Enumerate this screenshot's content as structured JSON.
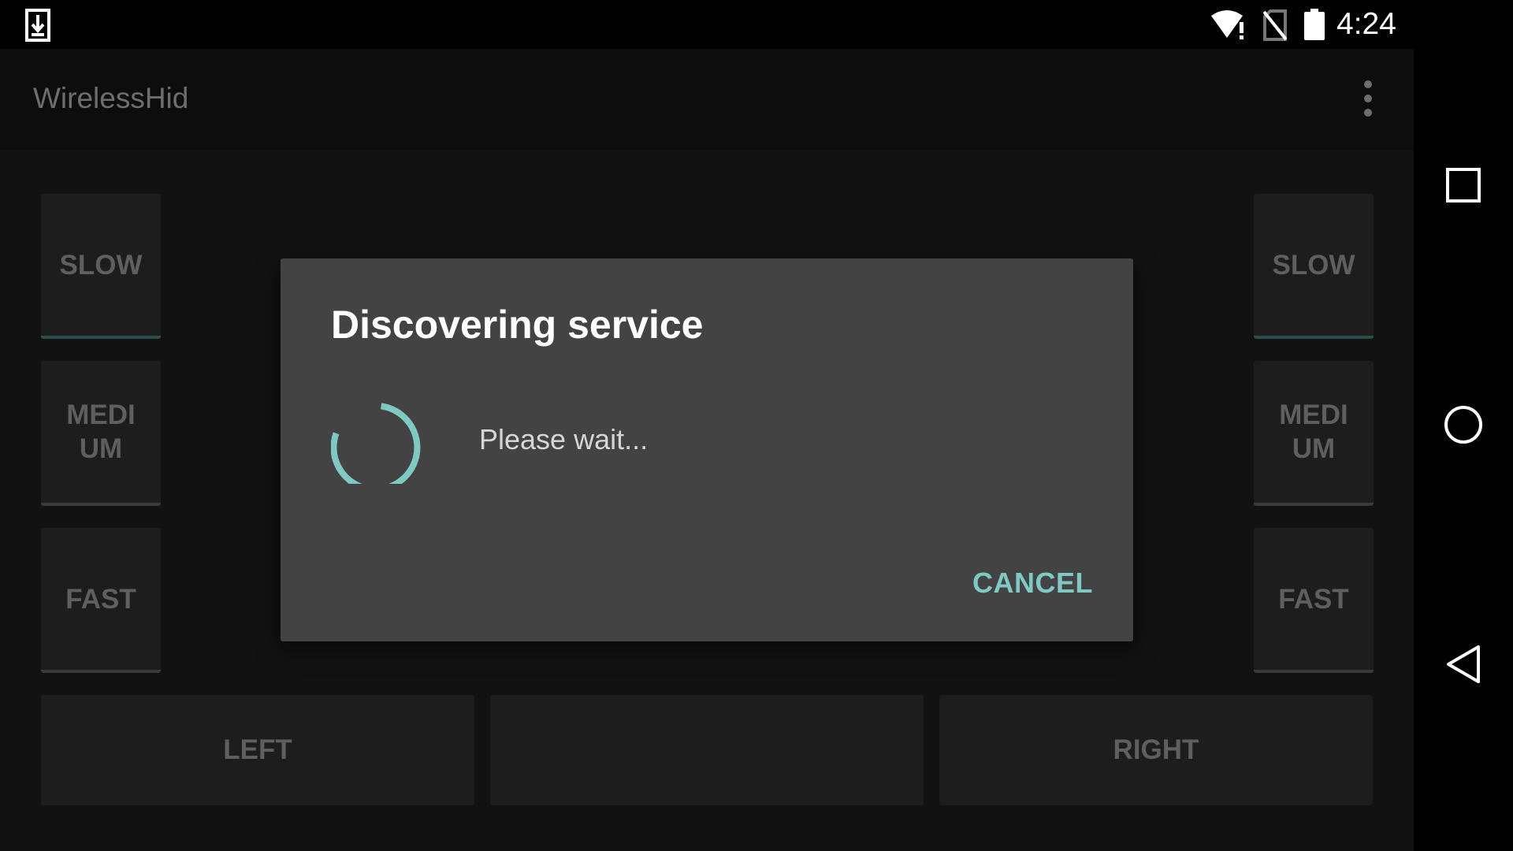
{
  "status_bar": {
    "time": "4:24",
    "icons": [
      "download-notification-icon",
      "wifi-alert-icon",
      "no-sim-icon",
      "battery-full-icon"
    ]
  },
  "app": {
    "title": "WirelessHid",
    "menu_icon": "overflow-menu-icon"
  },
  "left_column": [
    "SLOW",
    "MEDIUM",
    "FAST"
  ],
  "right_column": [
    "SLOW",
    "MEDIUM",
    "FAST"
  ],
  "bottom_row": {
    "left": "LEFT",
    "middle": "",
    "right": "RIGHT"
  },
  "dialog": {
    "title": "Discovering service",
    "message": "Please wait...",
    "cancel": "CANCEL"
  },
  "navigation": [
    "recents-icon",
    "home-icon",
    "back-icon"
  ],
  "colors": {
    "accent": "#7ecac3",
    "dialog_background": "#434343",
    "app_background": "#121212"
  }
}
